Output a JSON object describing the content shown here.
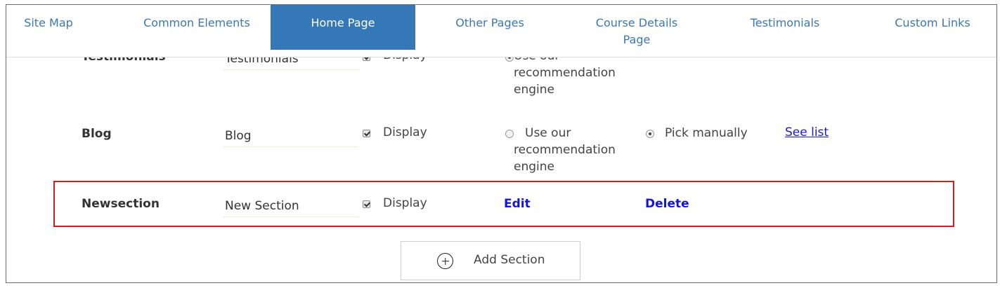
{
  "tabs": [
    {
      "label": "Site Map",
      "active": false
    },
    {
      "label": "Common Elements",
      "active": false
    },
    {
      "label": "Home Page",
      "active": true
    },
    {
      "label": "Other Pages",
      "active": false
    },
    {
      "label": "Course Details Page",
      "active": false
    },
    {
      "label": "Testimonials",
      "active": false
    },
    {
      "label": "Custom Links",
      "active": false
    }
  ],
  "sections": [
    {
      "name": "Testimonials",
      "input_value": "Testimonials",
      "display_label": "Display",
      "display_checked": true,
      "radio_recommend_label": "Use our recommendation engine",
      "radio_recommend_selected": true
    },
    {
      "name": "Blog",
      "input_value": "Blog",
      "display_label": "Display",
      "display_checked": true,
      "radio_recommend_label": "Use our recommendation engine",
      "radio_recommend_selected": false,
      "radio_manual_label": "Pick manually",
      "radio_manual_selected": true,
      "see_list_label": "See list"
    },
    {
      "name": "Newsection",
      "input_value": "New Section",
      "display_label": "Display",
      "display_checked": true,
      "edit_label": "Edit",
      "delete_label": "Delete",
      "highlighted": true
    }
  ],
  "add_section": {
    "label": "Add Section",
    "icon": "plus-circle-icon"
  },
  "colors": {
    "tab_active_bg": "#3478b7",
    "tab_text": "#3a78b4",
    "link": "#1a1ad0",
    "highlight_border": "#d61c1c"
  }
}
